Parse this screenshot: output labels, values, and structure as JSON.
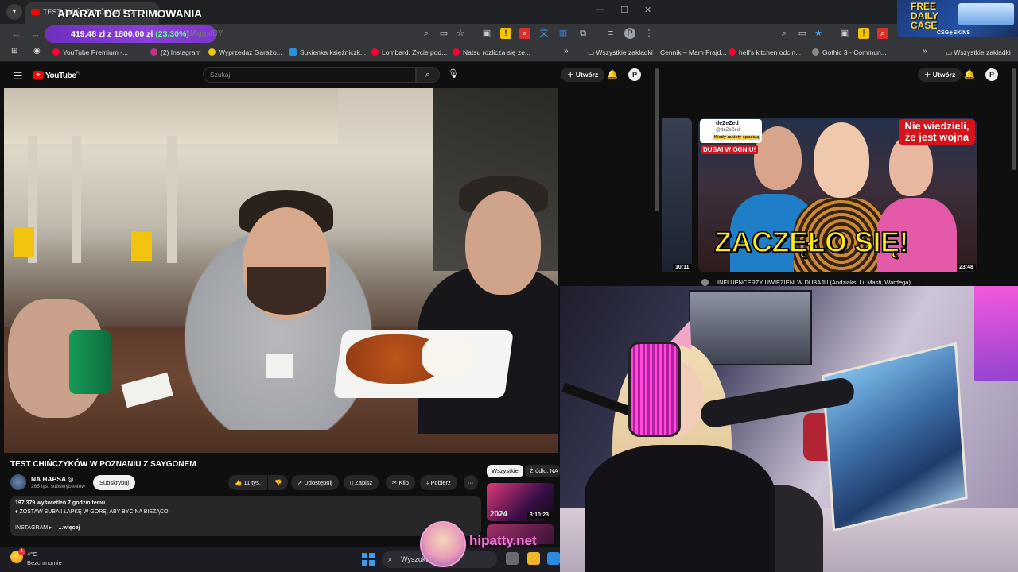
{
  "left_window": {
    "tab_title": "TEST CHIŃCZYKÓW W PO",
    "overlay_title": "APARAT DO STRIMOWANIA",
    "donation": {
      "current": "419,48 zł",
      "separator": "z",
      "goal": "1800,00 zł",
      "percent": "(23.30%)",
      "progress": 0.233
    },
    "url_fragment": "dAggsfBY",
    "bookmarks": [
      {
        "label": "YouTube Premium -...",
        "color": "#ff0033"
      },
      {
        "label": "(2) Instagram",
        "color": "#c13584"
      },
      {
        "label": "Wyprzedaż Garażo...",
        "color": "#f2c40f"
      },
      {
        "label": "Sukienka księżniczk...",
        "color": "#2b8fd6"
      },
      {
        "label": "Lombard. Życie pod...",
        "color": "#ff0033"
      },
      {
        "label": "Natsu rozlicza się ze...",
        "color": "#ff0033"
      }
    ],
    "bookmarks_more": "»",
    "all_bookmarks": "Wszystkie zakładki"
  },
  "youtube": {
    "logo": "YouTube",
    "logo_region": "PL",
    "search_placeholder": "Szukaj",
    "create_label": "Utwórz",
    "avatar_letter": "P",
    "video_title": "TEST CHIŃCZYKÓW W POZNANIU Z SAYGONEM",
    "channel_name": "NA HAPSA",
    "channel_subs": "265 tys. subskrybentów",
    "subscribe_label": "Subskrybuj",
    "likes": "11 tys.",
    "share_label": "Udostępnij",
    "save_label": "Zapisz",
    "clip_label": "Klip",
    "download_label": "Pobierz",
    "more_label": "···",
    "description": {
      "stats": "197 379 wyświetleń  7 godzin temu",
      "line2": "♦ ZOSTAW SUBA I ŁAPKĘ W GÓRĘ, ABY BYĆ NA BIEŻĄCO",
      "line3": "INSTAGRAM ▸",
      "more": "...więcej"
    },
    "chips": [
      "Wszystkie",
      "Źródło: NA H"
    ],
    "rec_durations": [
      "3:10:23"
    ],
    "rec_year": "2024"
  },
  "right_window": {
    "bookmarks": [
      "Cennik – Mam Frajd...",
      "hell's kitchen odcin...",
      "Gothic 3 - Commun..."
    ],
    "bookmarks_more": "»",
    "all_bookmarks": "Wszystkie zakładki",
    "create_label": "Utwórz",
    "avatar_letter": "P",
    "promo": {
      "title_line1": "FREE",
      "title_line2": "DAILY",
      "title_line3": "CASE",
      "brand": "CSG◈SKINS"
    },
    "thumbnail": {
      "headline": "ZACZĘŁO SIĘ!",
      "banner": "Nie wiedzieli, że jest wojna",
      "tweet_name": "deZeZed",
      "tweet_handle": "@deZeZed",
      "tweet_tag": "Kiedy rakiety spadają",
      "tag_red": "DUBAI W OGNIU!",
      "duration": "23:48",
      "side_duration": "10:11"
    },
    "video_title": "INFLUENCERZY UWIĘZIENI W DUBAJU (Andziaks, Lil Masti, Wardega)"
  },
  "taskbar": {
    "temperature": "4°C",
    "weather": "Bezchmurnie",
    "weather_badge": "1",
    "search_label": "Wyszukaj",
    "watermark": "hipatty.net"
  }
}
